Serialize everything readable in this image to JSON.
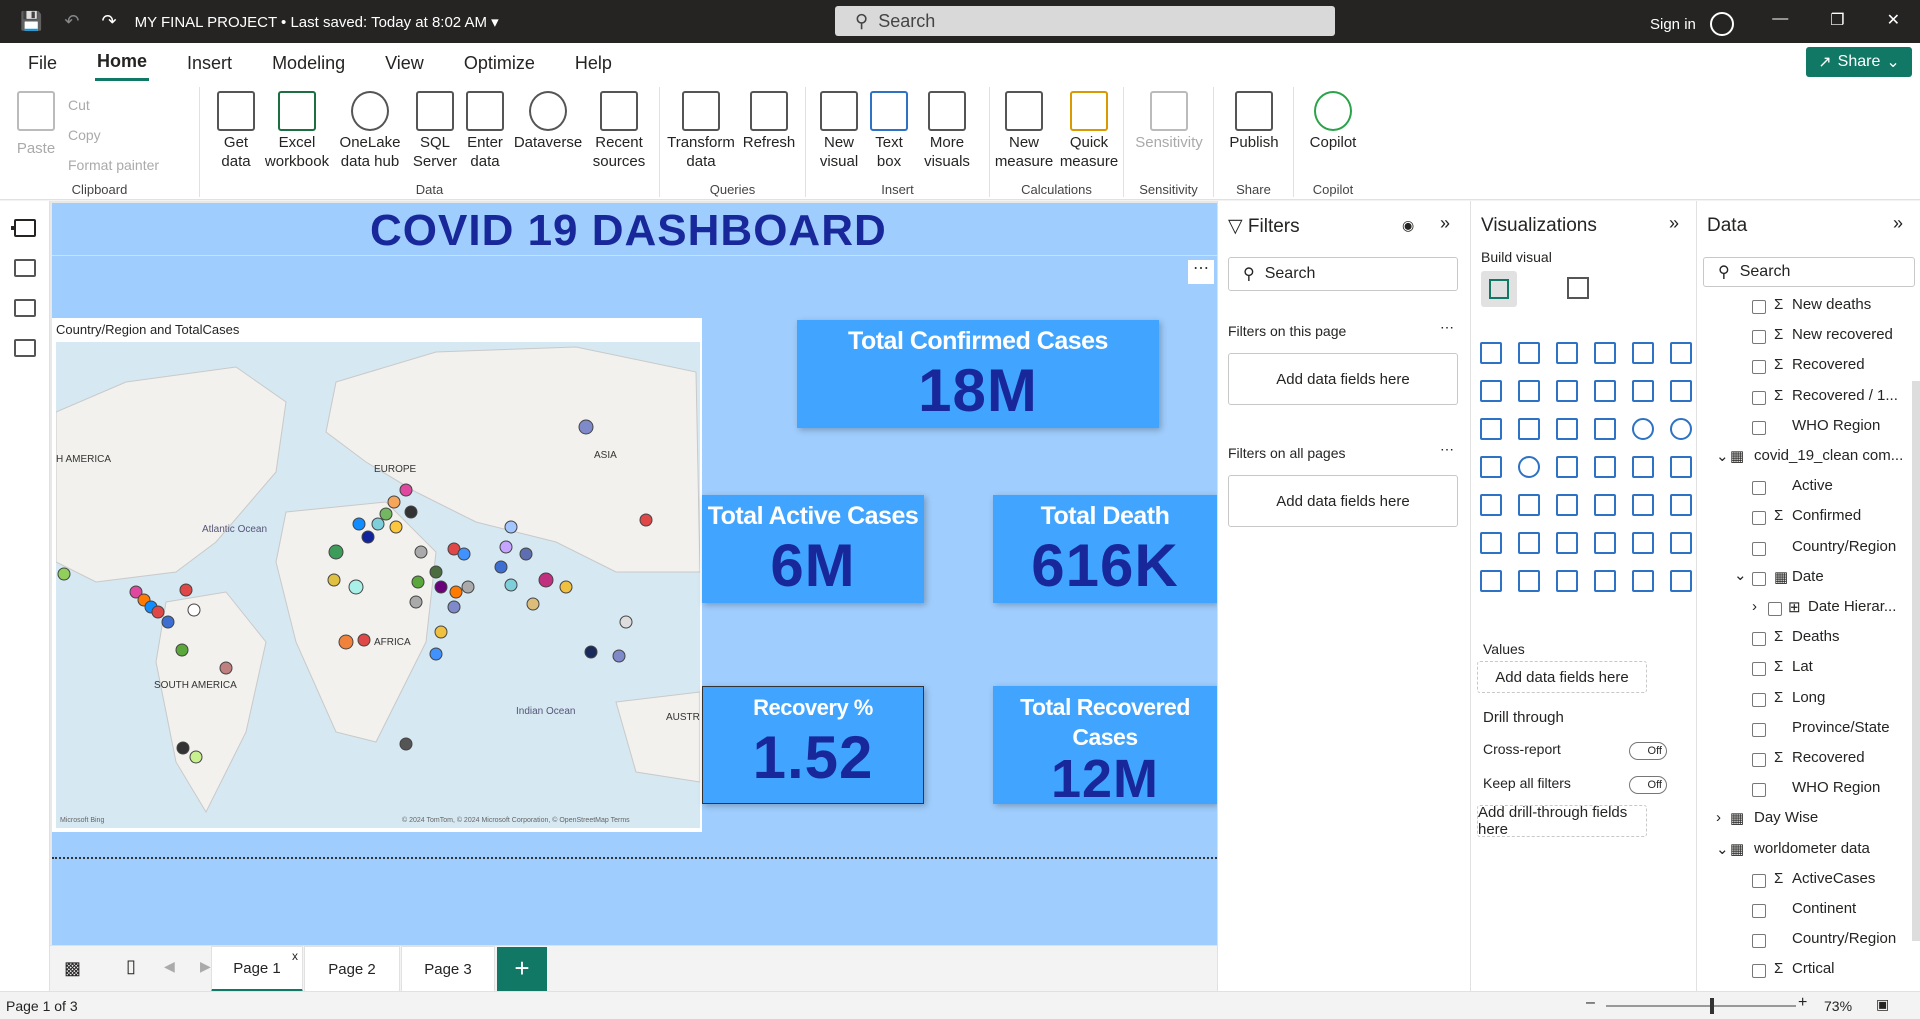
{
  "titlebar": {
    "doc_title": "MY FINAL PROJECT",
    "saved": "• Last saved: Today at 8:02 AM",
    "search": "Search",
    "sign_in": "Sign in"
  },
  "menu": {
    "items": [
      "File",
      "Home",
      "Insert",
      "Modeling",
      "View",
      "Optimize",
      "Help"
    ],
    "share": "Share"
  },
  "ribbon": {
    "clipboard": {
      "paste": "Paste",
      "cut": "Cut",
      "copy": "Copy",
      "format_painter": "Format painter",
      "label": "Clipboard"
    },
    "data": {
      "get_data": "Get data",
      "excel": "Excel workbook",
      "onelake": "OneLake data hub",
      "sql": "SQL Server",
      "enter": "Enter data",
      "dataverse": "Dataverse",
      "recent": "Recent sources",
      "label": "Data"
    },
    "queries": {
      "transform": "Transform data",
      "refresh": "Refresh",
      "label": "Queries"
    },
    "insert": {
      "new_visual": "New visual",
      "text_box": "Text box",
      "more_visuals": "More visuals",
      "label": "Insert"
    },
    "calculations": {
      "new_measure": "New measure",
      "quick_measure": "Quick measure",
      "label": "Calculations"
    },
    "sensitivity": {
      "sensitivity": "Sensitivity",
      "label": "Sensitivity"
    },
    "share": {
      "publish": "Publish",
      "label": "Share"
    },
    "copilot": {
      "copilot": "Copilot",
      "label": "Copilot"
    }
  },
  "dashboard": {
    "title": "COVID 19 DASHBOARD",
    "map_title": "Country/Region and TotalCases",
    "map_labels": {
      "na": "H AMERICA",
      "europe": "EUROPE",
      "asia": "ASIA",
      "atlantic": "Atlantic Ocean",
      "africa": "AFRICA",
      "sa": "SOUTH AMERICA",
      "indian": "Indian Ocean",
      "aus": "AUSTR",
      "bing": "Microsoft Bing",
      "copy": "© 2024 TomTom, © 2024 Microsoft Corporation, © OpenStreetMap  Terms"
    },
    "cards": {
      "confirmed": {
        "label": "Total Confirmed Cases",
        "value": "18M"
      },
      "active": {
        "label": "Total Active Cases",
        "value": "6M"
      },
      "death": {
        "label": "Total Death",
        "value": "616K"
      },
      "recovery": {
        "label": "Recovery %",
        "value": "1.52"
      },
      "recovered": {
        "label": "Total Recovered Cases",
        "value": "12M"
      }
    }
  },
  "pages": {
    "tabs": [
      "Page 1",
      "Page 2",
      "Page 3"
    ],
    "status": "Page 1 of 3",
    "zoom": "73%"
  },
  "filters": {
    "title": "Filters",
    "search": "Search",
    "this_page": "Filters on this page",
    "all_pages": "Filters on all pages",
    "add": "Add data fields here"
  },
  "viz": {
    "title": "Visualizations",
    "build": "Build visual",
    "values": "Values",
    "values_add": "Add data fields here",
    "drill": "Drill through",
    "cross": "Cross-report",
    "keep": "Keep all filters",
    "off": "Off",
    "drill_add": "Add drill-through fields here"
  },
  "data_pane": {
    "title": "Data",
    "search": "Search",
    "fields": [
      "New deaths",
      "New recovered",
      "Recovered",
      "Recovered / 1...",
      "WHO Region",
      "covid_19_clean com...",
      "Active",
      "Confirmed",
      "Country/Region",
      "Date",
      "Date Hierar...",
      "Deaths",
      "Lat",
      "Long",
      "Province/State",
      "Recovered",
      "WHO Region",
      "Day Wise",
      "worldometer data",
      "ActiveCases",
      "Continent",
      "Country/Region",
      "Crtical"
    ]
  }
}
